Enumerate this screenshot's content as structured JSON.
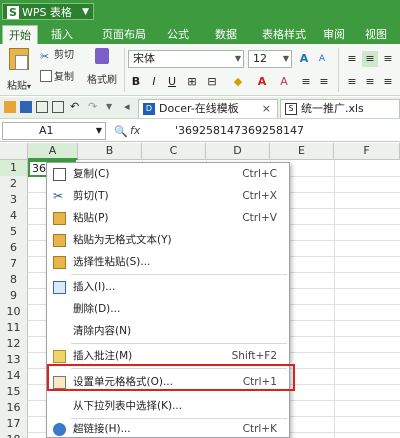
{
  "app": {
    "title": "WPS 表格",
    "logo": "S"
  },
  "ribbon_tabs": [
    "开始",
    "插入",
    "页面布局",
    "公式",
    "数据",
    "表格样式",
    "审阅",
    "视图"
  ],
  "ribbon": {
    "paste_label": "粘贴",
    "cut_label": "剪切",
    "copy_label": "复制",
    "format_painter_label": "格式刷",
    "font_name": "宋体",
    "font_size": "12",
    "bold": "B",
    "italic": "I",
    "underline": "U"
  },
  "doc_tabs": [
    {
      "badge": "D",
      "label": "Docer-在线模板"
    },
    {
      "badge": "S",
      "label": "统一推广.xls"
    }
  ],
  "formula_bar": {
    "cell_ref": "A1",
    "fx": "fx",
    "value": "'369258147369258147"
  },
  "columns": [
    "A",
    "B",
    "C",
    "D",
    "E",
    "F"
  ],
  "rows": [
    "1",
    "2",
    "3",
    "4",
    "5",
    "6",
    "7",
    "8",
    "9",
    "10",
    "11",
    "12",
    "13",
    "14",
    "15",
    "16",
    "17",
    "18"
  ],
  "cell_a1": "369258147369258147",
  "context_menu": [
    {
      "icon": "copy-icon",
      "label": "复制(C)",
      "shortcut": "Ctrl+C"
    },
    {
      "icon": "scissors-icon",
      "label": "剪切(T)",
      "shortcut": "Ctrl+X"
    },
    {
      "icon": "paste-icon",
      "label": "粘贴(P)",
      "shortcut": "Ctrl+V"
    },
    {
      "icon": "paste-text-icon",
      "label": "粘贴为无格式文本(Y)",
      "shortcut": ""
    },
    {
      "icon": "paste-special-icon",
      "label": "选择性粘贴(S)...",
      "shortcut": ""
    },
    {
      "icon": "insert-icon",
      "label": "插入(I)...",
      "shortcut": ""
    },
    {
      "icon": "",
      "label": "删除(D)...",
      "shortcut": ""
    },
    {
      "icon": "",
      "label": "清除内容(N)",
      "shortcut": ""
    },
    {
      "icon": "comment-icon",
      "label": "插入批注(M)",
      "shortcut": "Shift+F2"
    },
    {
      "icon": "format-cells-icon",
      "label": "设置单元格格式(O)...",
      "shortcut": "Ctrl+1"
    },
    {
      "icon": "",
      "label": "从下拉列表中选择(K)...",
      "shortcut": ""
    },
    {
      "icon": "hyperlink-icon",
      "label": "超链接(H)...",
      "shortcut": "Ctrl+K"
    }
  ],
  "colors": {
    "accent": "#3d9a3f",
    "highlight": "#e02020"
  }
}
